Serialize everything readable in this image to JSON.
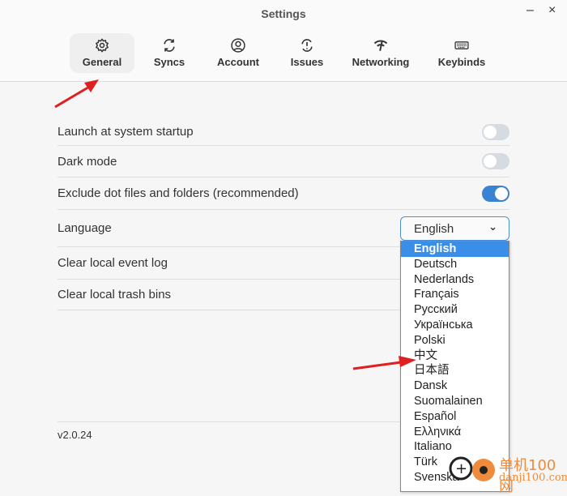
{
  "window": {
    "title": "Settings",
    "minimize": "–",
    "close": "×"
  },
  "tabs": [
    {
      "label": "General",
      "icon": "gear-icon",
      "active": true
    },
    {
      "label": "Syncs",
      "icon": "sync-icon"
    },
    {
      "label": "Account",
      "icon": "user-circle-icon"
    },
    {
      "label": "Issues",
      "icon": "alert-sync-icon"
    },
    {
      "label": "Networking",
      "icon": "wifi-icon"
    },
    {
      "label": "Keybinds",
      "icon": "keyboard-icon"
    }
  ],
  "settings": {
    "launch": {
      "label": "Launch at system startup",
      "on": false
    },
    "dark": {
      "label": "Dark mode",
      "on": false
    },
    "dotfiles": {
      "label": "Exclude dot files and folders (recommended)",
      "on": true
    },
    "language": {
      "label": "Language",
      "value": "English"
    },
    "clear_log": {
      "label": "Clear local event log"
    },
    "clear_trash": {
      "label": "Clear local trash bins"
    }
  },
  "language_options": [
    "English",
    "Deutsch",
    "Nederlands",
    "Français",
    "Русский",
    "Українська",
    "Polski",
    "中文",
    "日本語",
    "Dansk",
    "Suomalainen",
    "Español",
    "Ελληνικά",
    "Italiano",
    "Türk",
    "Svenska"
  ],
  "footer": {
    "version": "v2.0.24"
  },
  "watermark": {
    "text": "单机100网",
    "url": "danji100.com"
  },
  "colors": {
    "accent": "#3a82d2",
    "annotation": "#e02020"
  }
}
